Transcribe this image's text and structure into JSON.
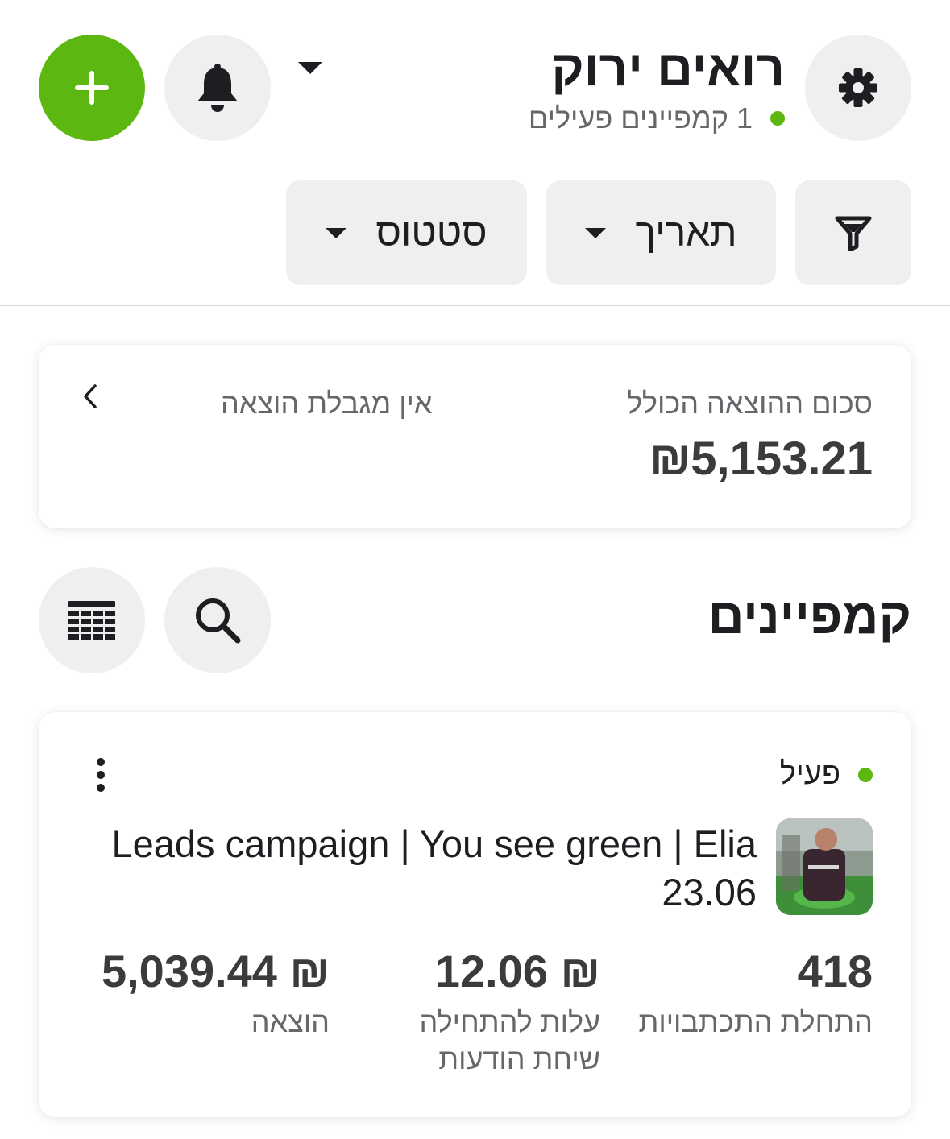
{
  "header": {
    "title": "רואים ירוק",
    "active_campaigns": "1 קמפיינים פעילים"
  },
  "filters": {
    "date_label": "תאריך",
    "status_label": "סטטוס"
  },
  "spend_summary": {
    "label": "סכום ההוצאה הכולל",
    "value": "₪5,153.21",
    "limit_label": "אין מגבלת הוצאה"
  },
  "campaigns_section": {
    "title": "קמפיינים"
  },
  "campaign": {
    "status": "פעיל",
    "name": "Leads campaign | You see green | Elia 23.06",
    "metrics": [
      {
        "value": "418",
        "label": "התחלת התכתבויות"
      },
      {
        "value": "₪ 12.06",
        "label": "עלות להתחילה שיחת הודעות"
      },
      {
        "value": "₪ 5,039.44",
        "label": "הוצאה"
      }
    ]
  },
  "colors": {
    "accent_green": "#5cb811",
    "button_gray": "#efefef",
    "text_primary": "#1c1e21",
    "text_secondary": "#65676b"
  }
}
